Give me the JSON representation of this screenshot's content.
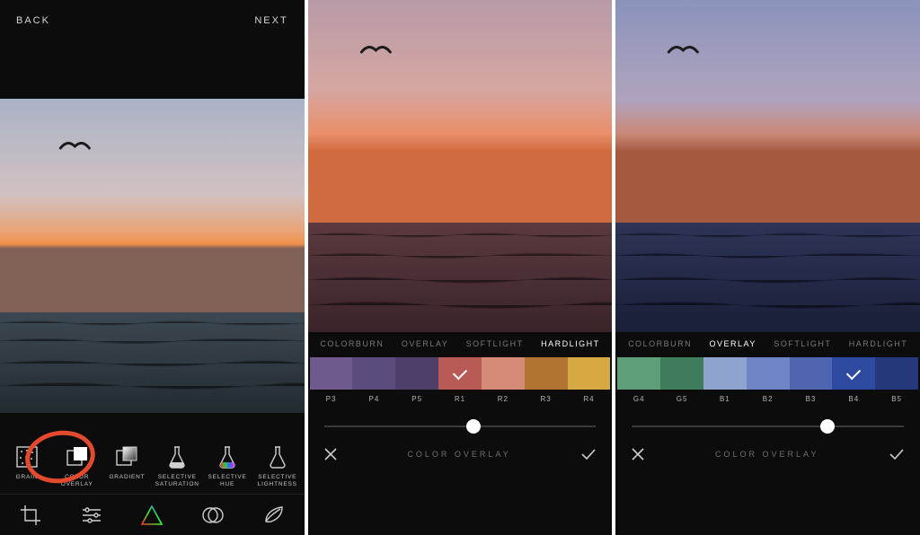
{
  "panelA": {
    "back": "BACK",
    "next": "NEXT",
    "tools": [
      {
        "id": "grain",
        "label": "GRAIN"
      },
      {
        "id": "color-overlay",
        "label": "COLOR\nOVERLAY"
      },
      {
        "id": "gradient",
        "label": "GRADIENT"
      },
      {
        "id": "selective-saturation",
        "label": "SELECTIVE\nSATURATION"
      },
      {
        "id": "selective-hue",
        "label": "SELECTIVE\nHUE"
      },
      {
        "id": "selective-lightness",
        "label": "SELECTIVE\nLIGHTNESS"
      }
    ]
  },
  "panelB": {
    "blend_modes": [
      {
        "label": "COLORBURN",
        "active": false
      },
      {
        "label": "OVERLAY",
        "active": false
      },
      {
        "label": "SOFTLIGHT",
        "active": false
      },
      {
        "label": "HARDLIGHT",
        "active": true
      }
    ],
    "swatches": [
      {
        "code": "P3",
        "hex": "#6f5a8d",
        "selected": false
      },
      {
        "code": "P4",
        "hex": "#5a4c7d",
        "selected": false
      },
      {
        "code": "P5",
        "hex": "#4d3f6a",
        "selected": false
      },
      {
        "code": "R1",
        "hex": "#b85b56",
        "selected": true
      },
      {
        "code": "R2",
        "hex": "#d58b78",
        "selected": false
      },
      {
        "code": "R3",
        "hex": "#b27531",
        "selected": false
      },
      {
        "code": "R4",
        "hex": "#d7a942",
        "selected": false
      }
    ],
    "slider_pct": 55,
    "footer": "COLOR OVERLAY"
  },
  "panelC": {
    "blend_modes": [
      {
        "label": "COLORBURN",
        "active": false
      },
      {
        "label": "OVERLAY",
        "active": true
      },
      {
        "label": "SOFTLIGHT",
        "active": false
      },
      {
        "label": "HARDLIGHT",
        "active": false
      }
    ],
    "swatches": [
      {
        "code": "G4",
        "hex": "#5e9e79",
        "selected": false
      },
      {
        "code": "G5",
        "hex": "#3f7c5c",
        "selected": false
      },
      {
        "code": "B1",
        "hex": "#8ea4cf",
        "selected": false
      },
      {
        "code": "B2",
        "hex": "#6f86c6",
        "selected": false
      },
      {
        "code": "B3",
        "hex": "#4f65b0",
        "selected": false
      },
      {
        "code": "B4",
        "hex": "#2e4aa0",
        "selected": true
      },
      {
        "code": "B5",
        "hex": "#24387a",
        "selected": false
      }
    ],
    "slider_pct": 72,
    "footer": "COLOR OVERLAY"
  }
}
